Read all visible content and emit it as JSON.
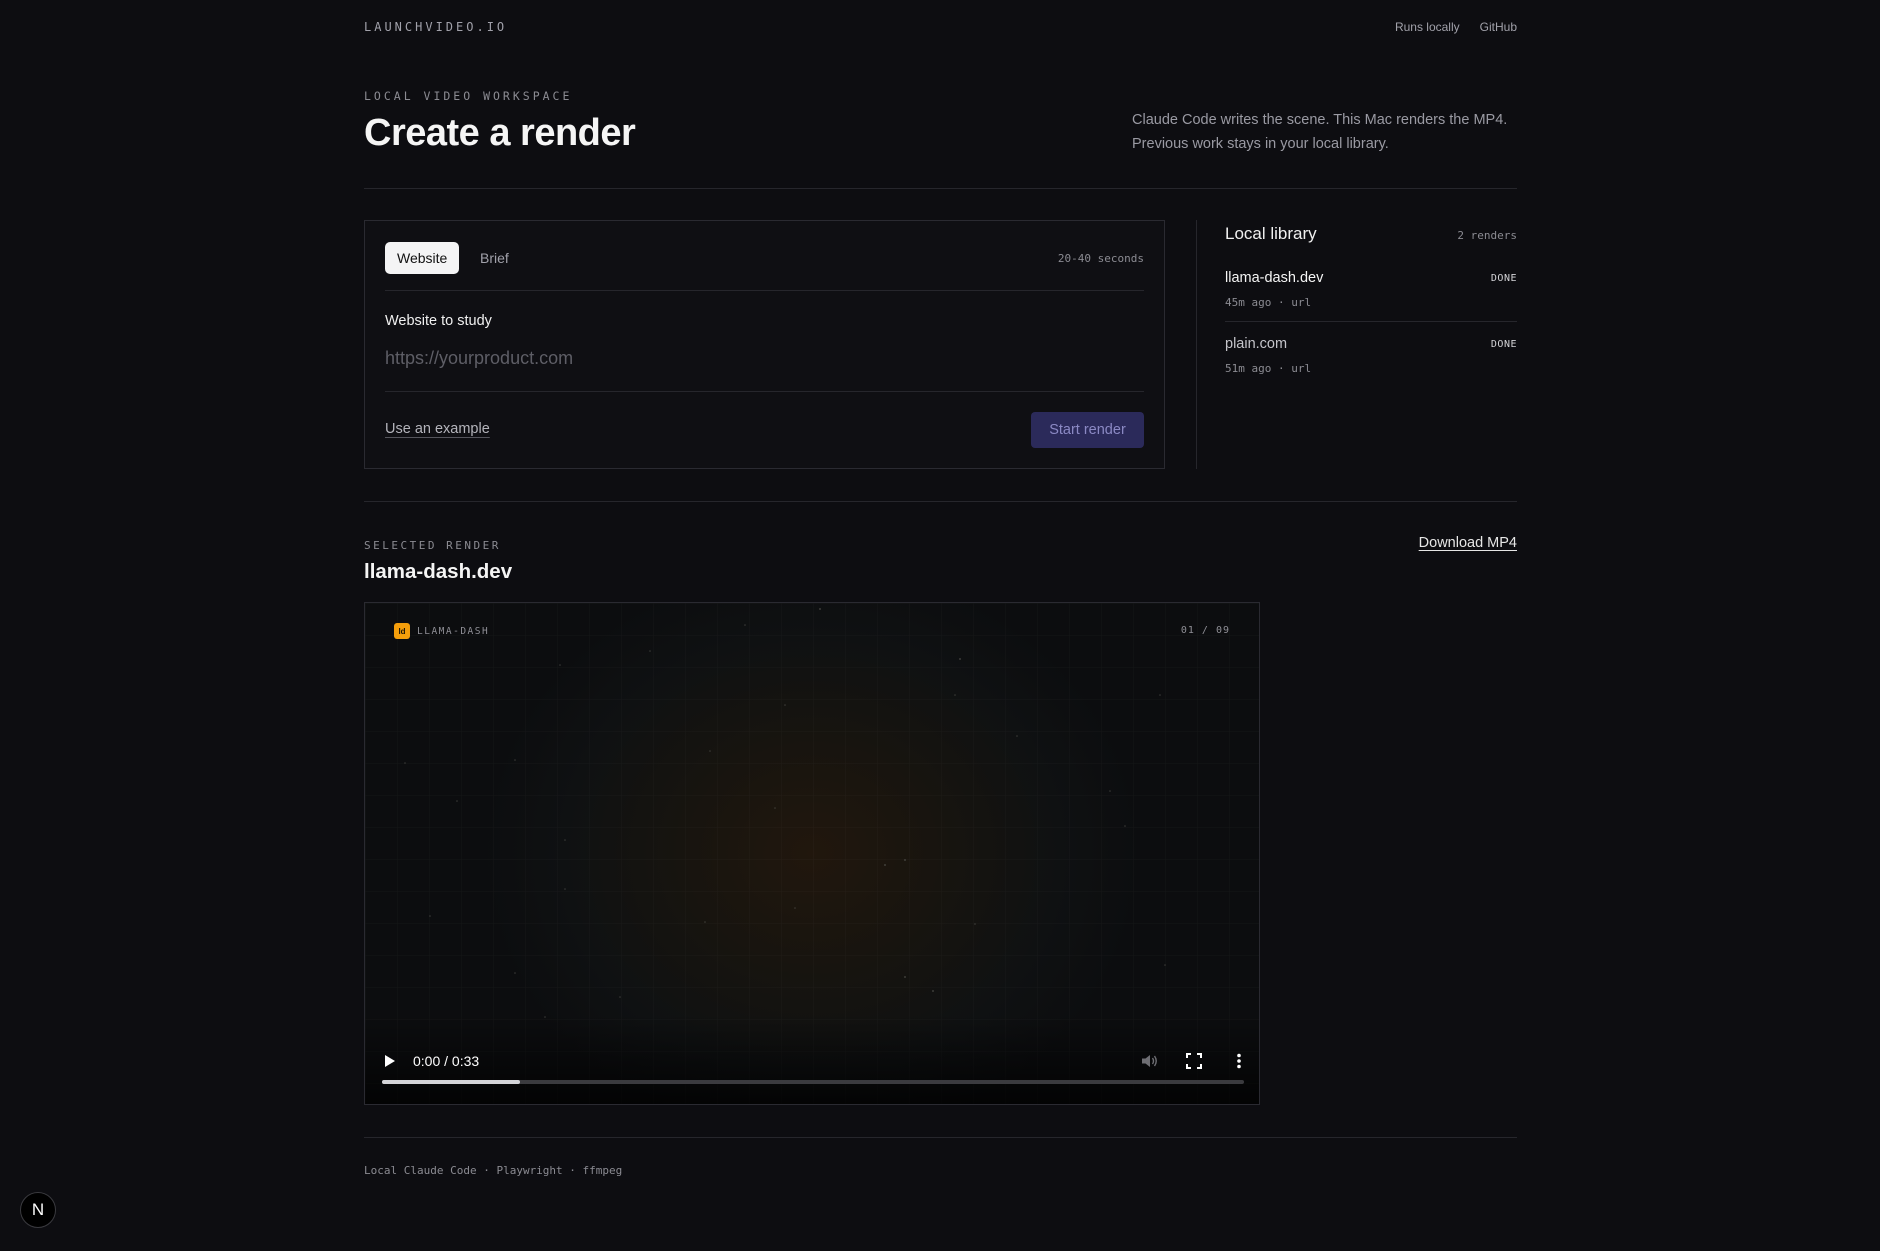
{
  "nav": {
    "brand": "LAUNCHVIDEO.IO",
    "links": [
      "Runs locally",
      "GitHub"
    ]
  },
  "header": {
    "eyebrow": "LOCAL VIDEO WORKSPACE",
    "title": "Create a render",
    "intro": "Claude Code writes the scene. This Mac renders the MP4. Previous work stays in your local library."
  },
  "form": {
    "tabs": [
      {
        "label": "Website",
        "active": true
      },
      {
        "label": "Brief",
        "active": false
      }
    ],
    "duration": "20-40 seconds",
    "field_label": "Website to study",
    "url_placeholder": "https://yourproduct.com",
    "url_value": "",
    "example_link": "Use an example",
    "submit_label": "Start render"
  },
  "library": {
    "title": "Local library",
    "count": "2 renders",
    "items": [
      {
        "name": "llama-dash.dev",
        "meta": "45m ago · url",
        "status": "DONE",
        "selected": true
      },
      {
        "name": "plain.com",
        "meta": "51m ago · url",
        "status": "DONE",
        "selected": false
      }
    ]
  },
  "selected": {
    "eyebrow": "SELECTED RENDER",
    "title": "llama-dash.dev",
    "download_label": "Download MP4"
  },
  "video": {
    "logo_mark": "ld",
    "logo_text": "LLAMA-DASH",
    "scene_counter": "01 / 09",
    "time": "0:00 / 0:33",
    "buffered_fraction": 0.16,
    "icons": [
      "play-icon",
      "volume-muted-icon",
      "fullscreen-icon",
      "more-options-icon"
    ]
  },
  "footer": {
    "text": "Local Claude Code · Playwright · ffmpeg"
  },
  "dev_badge": {
    "letter": "N"
  },
  "colors": {
    "background": "#0d0d11",
    "accent_button": "#2b2a5a",
    "logo_orange": "#f59e0b"
  }
}
